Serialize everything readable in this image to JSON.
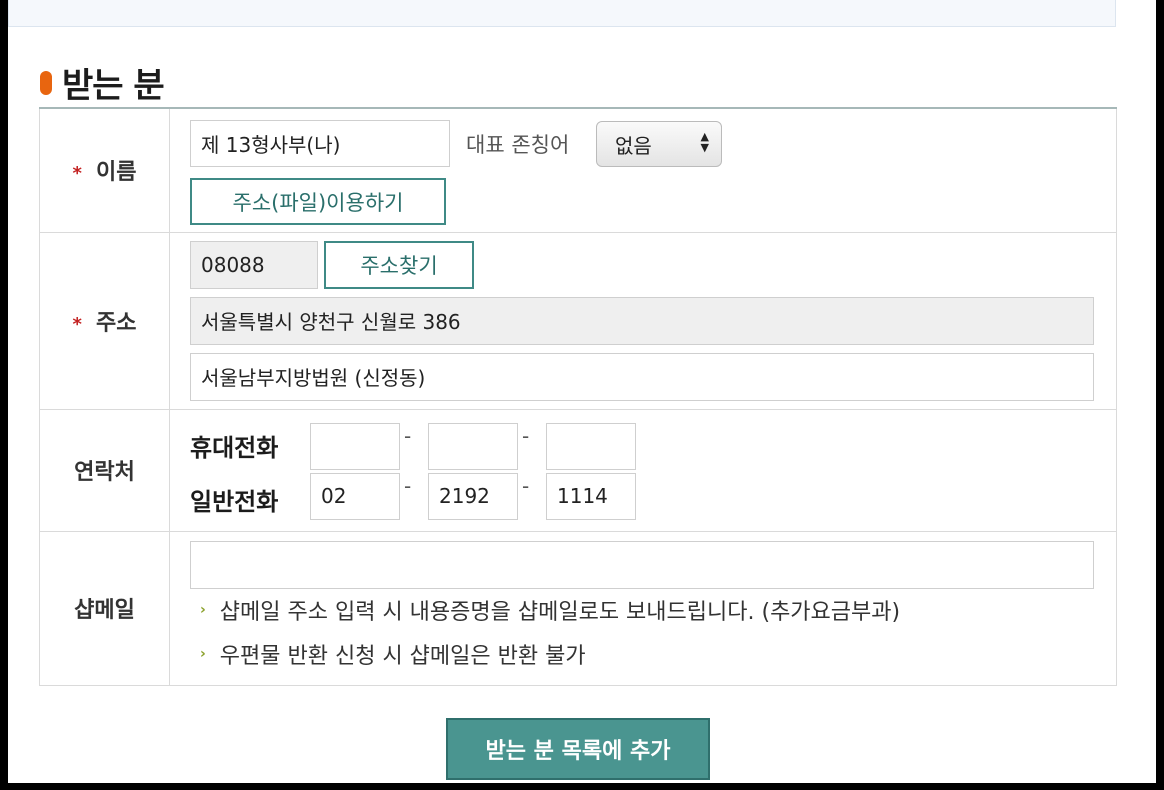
{
  "section": {
    "title": "받는 분"
  },
  "name_row": {
    "label": "이름",
    "required_mark": "*",
    "name_value": "제 13형사부(나)",
    "honorific_label": "대표 존칭어",
    "honorific_selected": "없음",
    "file_button": "주소(파일)이용하기"
  },
  "address_row": {
    "label": "주소",
    "required_mark": "*",
    "postal_code": "08088",
    "find_button": "주소찾기",
    "address_line1": "서울특별시 양천구 신월로 386",
    "address_line2": "서울남부지방법원 (신정동)"
  },
  "contact_row": {
    "label": "연락처",
    "mobile_label": "휴대전화",
    "mobile": [
      "",
      "",
      ""
    ],
    "landline_label": "일반전화",
    "landline": [
      "02",
      "2192",
      "1114"
    ],
    "dash": "-"
  },
  "email_row": {
    "label": "샵메일",
    "value": "",
    "notes": [
      "샵메일 주소 입력 시 내용증명을 샵메일로도 보내드립니다. (추가요금부과)",
      "우편물 반환 신청 시 샵메일은 반환 불가"
    ]
  },
  "submit_button": "받는 분 목록에 추가"
}
